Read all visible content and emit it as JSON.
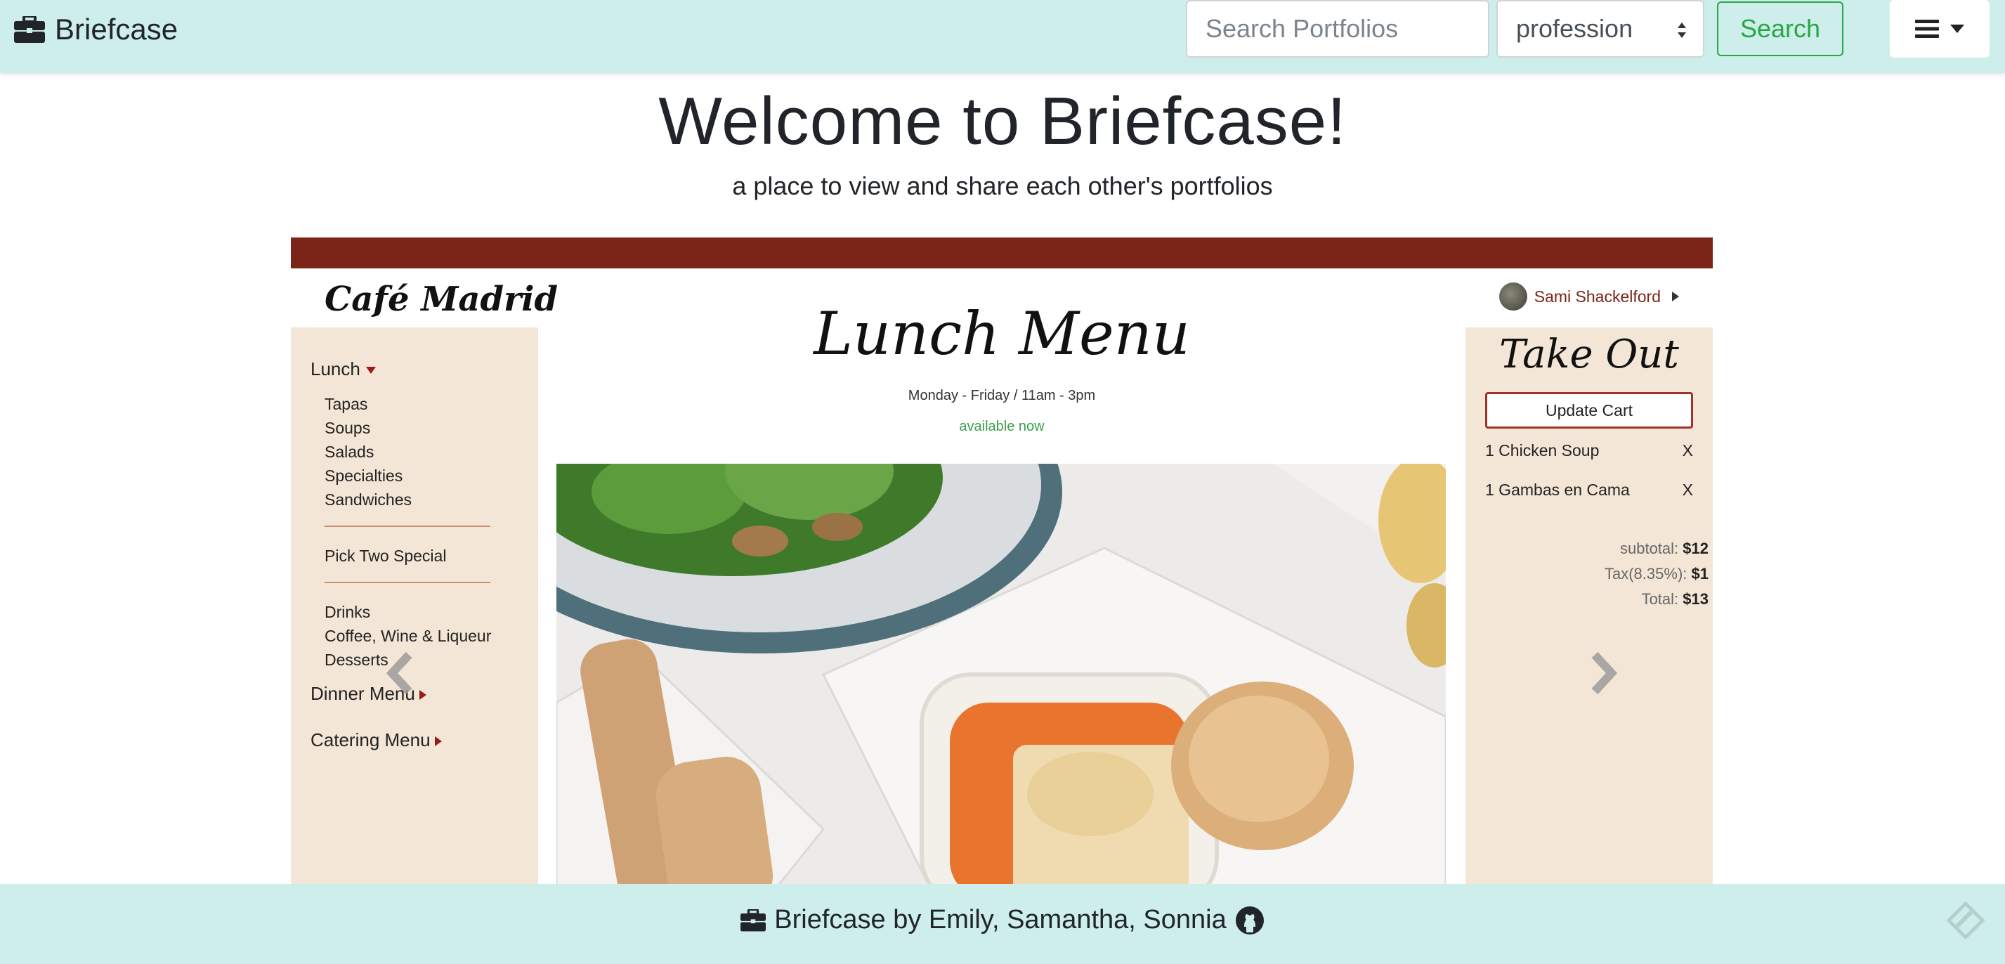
{
  "navbar": {
    "brand": "Briefcase",
    "search_placeholder": "Search Portfolios",
    "search_filter": "profession",
    "search_button": "Search",
    "menu_icon": "hamburger-icon"
  },
  "hero": {
    "title": "Welcome to Briefcase!",
    "subtitle": "a place to view and share each other's portfolios"
  },
  "carousel": {
    "slide": {
      "logo": "Café Madrid",
      "user_name": "Sami Shackelford",
      "menu_title": "Lunch",
      "menu_items": [
        "Tapas",
        "Soups",
        "Salads",
        "Specialties",
        "Sandwiches"
      ],
      "special": "Pick Two Special",
      "extra_items": [
        "Drinks",
        "Coffee, Wine & Liqueur",
        "Desserts"
      ],
      "dinner_menu": "Dinner Menu",
      "catering_menu": "Catering Menu",
      "page_title": "Lunch Menu",
      "hours": "Monday - Friday / 11am - 3pm",
      "availability": "available now",
      "takeout_title": "Take Out",
      "update_cart": "Update Cart",
      "cart": [
        {
          "item": "1 Chicken Soup",
          "remove": "X"
        },
        {
          "item": "1 Gambas en Cama",
          "remove": "X"
        }
      ],
      "subtotal_label": "subtotal:",
      "subtotal": "$12",
      "tax_label": "Tax(8.35%):",
      "tax": "$1",
      "total_label": "Total:",
      "total": "$13",
      "colors": {
        "accent": "#7b2418",
        "panel": "#f4e6d6",
        "available": "#3aa04a"
      }
    },
    "prev_icon": "chevron-left-icon",
    "next_icon": "chevron-right-icon"
  },
  "footer": {
    "text": "Briefcase by Emily, Samantha, Sonnia",
    "icons": [
      "briefcase-icon",
      "github-icon"
    ]
  },
  "colors": {
    "navbar": "#cdeeeb",
    "search_button": "#28a745"
  }
}
